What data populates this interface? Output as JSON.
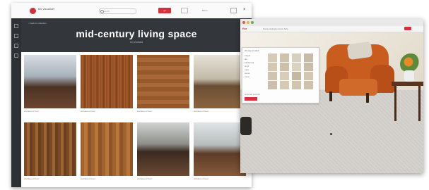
{
  "gallery_app": {
    "logo_text": "flor visualizer",
    "search_placeholder": "search",
    "go_label": "go",
    "menu_label": "Menu",
    "close_label": "×",
    "breadcrumb": "< back to collection",
    "title": "mid-century living space",
    "subtitle": "10 products",
    "tiles": [
      {
        "caption": "Hardwood Floor",
        "style": "room-a"
      },
      {
        "caption": "Hardwood Floor",
        "style": "wood-a"
      },
      {
        "caption": "Hardwood Floor",
        "style": "wood-d"
      },
      {
        "caption": "Hardwood Floor",
        "style": "room-b"
      },
      {
        "caption": "Hardwood Floor",
        "style": "wood-b"
      },
      {
        "caption": "Hardwood Floor",
        "style": "wood-c"
      },
      {
        "caption": "Hardwood Floor",
        "style": "room-c"
      },
      {
        "caption": "Hardwood Floor",
        "style": "room-d"
      }
    ]
  },
  "visualizer_app": {
    "logo": "flor",
    "nav": "home   products   rooms   help",
    "panel": {
      "header": "choose product",
      "list": [
        "carpet",
        "tile",
        "hardwood",
        "vinyl",
        "rugs",
        "stone",
        "more"
      ],
      "footer": "selected product",
      "swatch_colors": [
        "#d7cbb5",
        "#cfc3ad",
        "#d9cfc0",
        "#c7bca9",
        "#d5c8b3",
        "#cdbfa8",
        "#dcd2c1",
        "#c9bdaa",
        "#d0c4ae",
        "#d8cdb9",
        "#c4b8a3",
        "#d3c7b2",
        "#cbbfab",
        "#d6cab5",
        "#d1c5b0",
        "#cfc2ad"
      ]
    }
  }
}
